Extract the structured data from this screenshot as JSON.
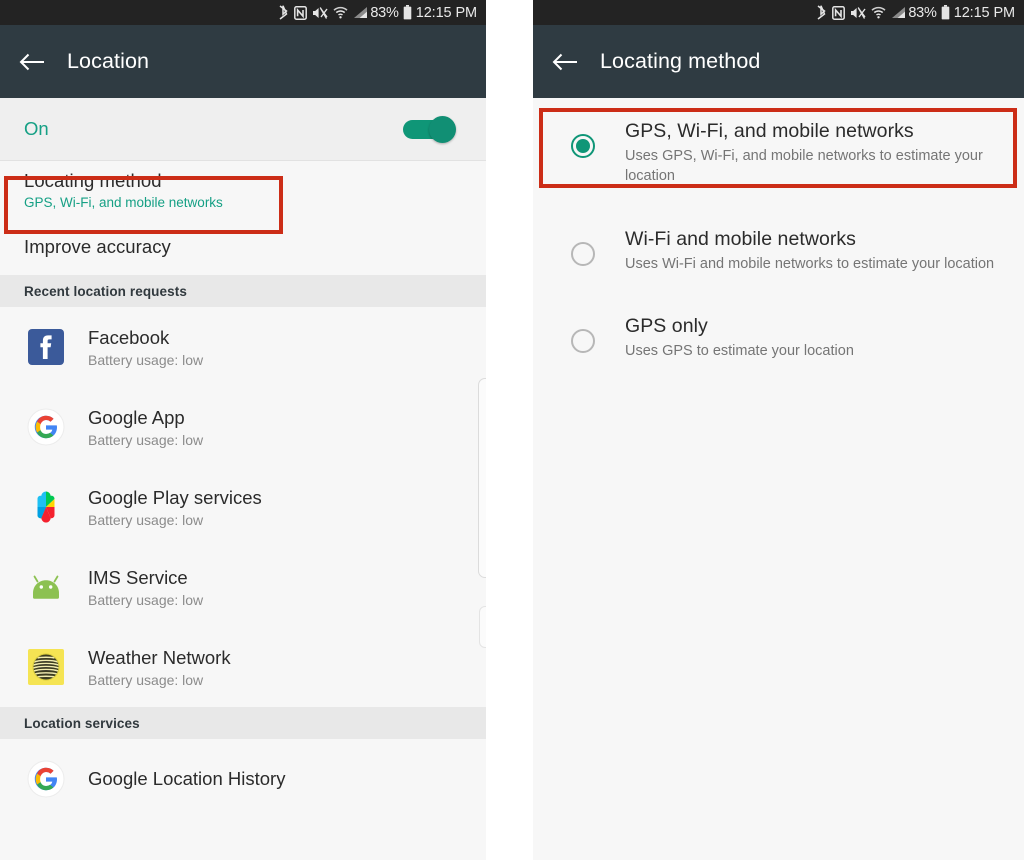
{
  "statusbar": {
    "icons": [
      "bluetooth-icon",
      "nfc-icon",
      "mute-vibrate-icon",
      "wifi-icon",
      "cellular-signal-icon"
    ],
    "battery_percent": "83%",
    "battery_icon": "battery-icon",
    "clock": "12:15 PM"
  },
  "colors": {
    "accent_teal": "#16a085",
    "toggle_green": "#0f9677",
    "annotation_red": "#cc2d17",
    "statusbar_bg": "#232323",
    "appbar_bg": "#2f3b42",
    "list_bg": "#f7f7f7",
    "section_header_bg": "#e8e8e8"
  },
  "left_screen": {
    "appbar": {
      "back_icon": "back-arrow-icon",
      "title": "Location"
    },
    "master_toggle": {
      "label": "On",
      "state": "on"
    },
    "settings_rows": [
      {
        "title": "Locating method",
        "subtitle": "GPS, Wi-Fi, and mobile networks",
        "highlighted": true
      },
      {
        "title": "Improve accuracy",
        "subtitle": "",
        "highlighted": false
      }
    ],
    "recent_requests": {
      "header": "Recent location requests",
      "items": [
        {
          "name": "Facebook",
          "battery": "Battery usage: low",
          "icon": "facebook-icon"
        },
        {
          "name": "Google App",
          "battery": "Battery usage: low",
          "icon": "google-g-icon"
        },
        {
          "name": "Google Play services",
          "battery": "Battery usage: low",
          "icon": "google-play-services-icon"
        },
        {
          "name": "IMS Service",
          "battery": "Battery usage: low",
          "icon": "android-robot-icon"
        },
        {
          "name": "Weather Network",
          "battery": "Battery usage: low",
          "icon": "weather-network-icon"
        }
      ]
    },
    "location_services": {
      "header": "Location services",
      "items": [
        {
          "name": "Google Location History",
          "icon": "google-g-icon"
        }
      ]
    }
  },
  "right_screen": {
    "appbar": {
      "back_icon": "back-arrow-icon",
      "title": "Locating method"
    },
    "options": [
      {
        "title": "GPS, Wi-Fi, and mobile networks",
        "description": "Uses GPS, Wi-Fi, and mobile networks to estimate your location",
        "selected": true,
        "highlighted": true
      },
      {
        "title": "Wi-Fi and mobile networks",
        "description": "Uses Wi-Fi and mobile networks to estimate your location",
        "selected": false,
        "highlighted": false
      },
      {
        "title": "GPS only",
        "description": "Uses GPS to estimate your location",
        "selected": false,
        "highlighted": false
      }
    ]
  }
}
